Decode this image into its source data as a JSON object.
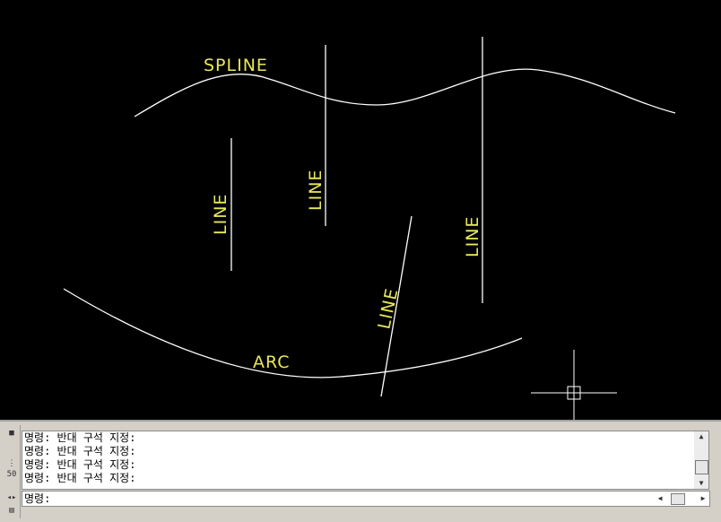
{
  "drawing": {
    "labels": {
      "spline": "SPLINE",
      "line_1": "LINE",
      "line_2": "LINE",
      "line_3": "LINE",
      "line_4": "LINE",
      "arc": "ARC"
    }
  },
  "command_window": {
    "side_icons": [
      "pin-icon",
      "properties-icon",
      "customize-icon"
    ],
    "side_number": "50",
    "history": [
      "명령: 반대 구석 지정:",
      "명령: 반대 구석 지정:",
      "명령: 반대 구석 지정:",
      "명령: 반대 구석 지정:"
    ],
    "prompt_label": "명령:",
    "prompt_value": ""
  },
  "colors": {
    "canvas_bg": "#000000",
    "geometry": "#ffffff",
    "annotation_text": "#e8e85a"
  }
}
